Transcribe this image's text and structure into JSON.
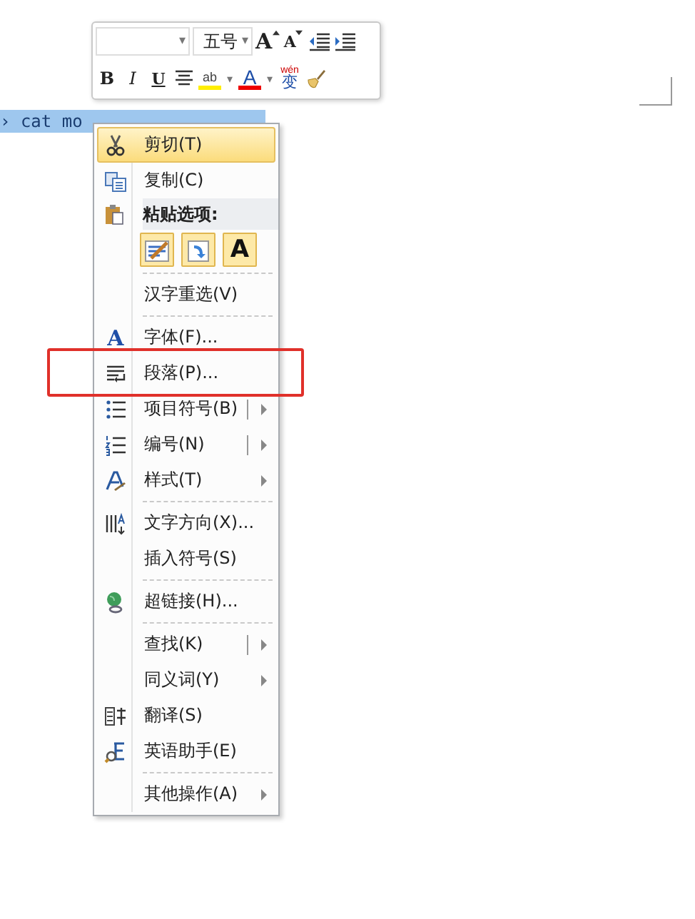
{
  "mini_toolbar": {
    "font_name": {
      "value_dropdown": "▾"
    },
    "font_size": {
      "value": "五号",
      "dropdown": "▾"
    },
    "row1_buttons": [
      {
        "kind": "grow",
        "text": "A"
      },
      {
        "kind": "shrink",
        "text": "A"
      },
      {
        "kind": "outdent"
      },
      {
        "kind": "indent"
      }
    ],
    "row2_buttons": [
      {
        "kind": "bold",
        "text": "B"
      },
      {
        "kind": "italic",
        "text": "I"
      },
      {
        "kind": "underline",
        "text": "U"
      },
      {
        "kind": "center"
      },
      {
        "kind": "highlight",
        "text": "ab"
      },
      {
        "kind": "dropdown",
        "text": "▾"
      },
      {
        "kind": "fontcolor",
        "text": "A"
      },
      {
        "kind": "dropdown",
        "text": "▾"
      },
      {
        "kind": "phonetic",
        "text": "wén",
        "sub": "变"
      },
      {
        "kind": "painter"
      }
    ]
  },
  "document": {
    "selected_text": "› cat mo"
  },
  "context_menu": {
    "items": [
      {
        "kind": "item",
        "label": "剪切(T)",
        "highlighted": true,
        "submenu": false,
        "split": false
      },
      {
        "kind": "item",
        "label": "复制(C)",
        "highlighted": false,
        "submenu": false,
        "split": false
      },
      {
        "kind": "header",
        "label": "粘贴选项:"
      },
      {
        "kind": "paste",
        "options": [
          {
            "kind": "keep"
          },
          {
            "kind": "merge"
          },
          {
            "kind": "text",
            "text": "A"
          }
        ]
      },
      {
        "kind": "separator"
      },
      {
        "kind": "item",
        "label": "汉字重选(V)",
        "highlighted": false,
        "submenu": false,
        "split": false
      },
      {
        "kind": "separator"
      },
      {
        "kind": "item",
        "label": "字体(F)...",
        "icon_text": "A",
        "highlighted": false,
        "submenu": false,
        "split": false
      },
      {
        "kind": "item",
        "label": "段落(P)...",
        "highlighted": false,
        "submenu": false,
        "split": false
      },
      {
        "kind": "item",
        "label": "项目符号(B)",
        "highlighted": false,
        "submenu": true,
        "split": true
      },
      {
        "kind": "item",
        "label": "编号(N)",
        "highlighted": false,
        "submenu": true,
        "split": true
      },
      {
        "kind": "item",
        "label": "样式(T)",
        "highlighted": false,
        "submenu": true,
        "split": false
      },
      {
        "kind": "separator"
      },
      {
        "kind": "item",
        "label": "文字方向(X)...",
        "highlighted": false,
        "submenu": false,
        "split": false
      },
      {
        "kind": "item",
        "label": "插入符号(S)",
        "highlighted": false,
        "submenu": false,
        "split": false
      },
      {
        "kind": "separator"
      },
      {
        "kind": "item",
        "label": "超链接(H)...",
        "highlighted": false,
        "submenu": false,
        "split": false
      },
      {
        "kind": "separator"
      },
      {
        "kind": "item",
        "label": "查找(K)",
        "highlighted": false,
        "submenu": true,
        "split": true
      },
      {
        "kind": "item",
        "label": "同义词(Y)",
        "highlighted": false,
        "submenu": true,
        "split": false
      },
      {
        "kind": "item",
        "label": "翻译(S)",
        "highlighted": false,
        "submenu": false,
        "split": false
      },
      {
        "kind": "item",
        "label": "英语助手(E)",
        "highlighted": false,
        "submenu": false,
        "split": false
      },
      {
        "kind": "separator"
      },
      {
        "kind": "item",
        "label": "其他操作(A)",
        "highlighted": false,
        "submenu": true,
        "split": false
      }
    ]
  }
}
